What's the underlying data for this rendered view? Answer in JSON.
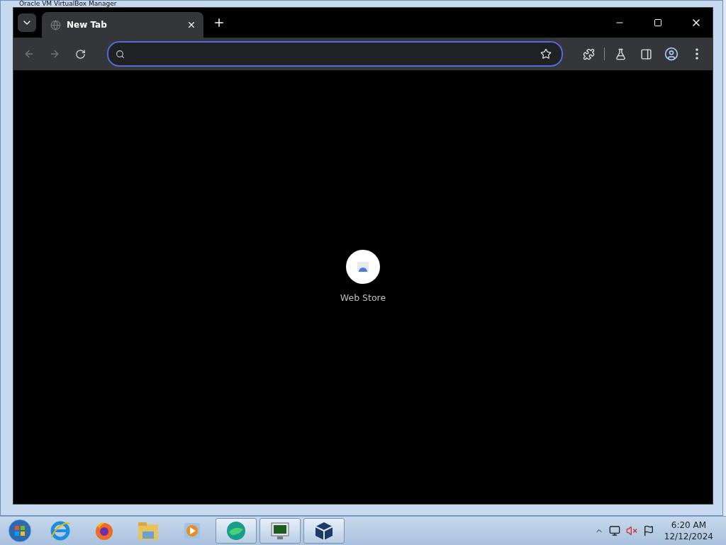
{
  "background_window": {
    "title": "Oracle VM VirtualBox Manager"
  },
  "browser": {
    "tabs": [
      {
        "title": "New Tab",
        "selected": true
      }
    ],
    "address_bar": {
      "focused": true
    },
    "shortcuts": [
      {
        "label": "Web Store"
      }
    ]
  },
  "taskbar": {
    "apps": [
      {
        "kind": "ie",
        "running": false
      },
      {
        "kind": "firefox",
        "running": false
      },
      {
        "kind": "explorer",
        "running": false
      },
      {
        "kind": "media",
        "running": false
      },
      {
        "kind": "edge",
        "running": true
      },
      {
        "kind": "monitor",
        "running": true
      },
      {
        "kind": "virtualbox",
        "running": true
      }
    ],
    "time": "6:20 AM",
    "date": "12/12/2024"
  }
}
